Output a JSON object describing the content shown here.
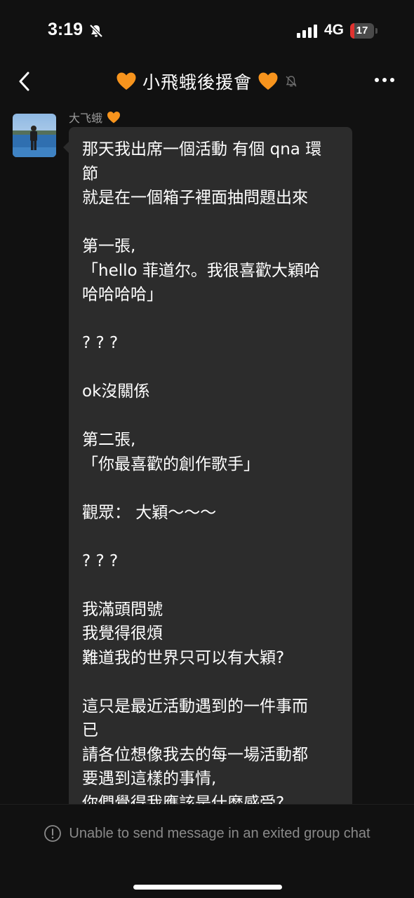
{
  "status_bar": {
    "time": "3:19",
    "network": "4G",
    "battery_level": "17",
    "battery_fraction": 0.17,
    "icons": [
      "bell-slash-icon",
      "signal-bars-icon",
      "battery-icon"
    ]
  },
  "header": {
    "title": "小飛蛾後援會",
    "icons": [
      "back-chevron-icon",
      "orange-heart-icon",
      "muted-bell-icon",
      "more-dots-icon"
    ],
    "accent_color": "#f7941d"
  },
  "message": {
    "sender_name": "大飞蛾",
    "sender_icon": "orange-heart-icon",
    "lines": [
      "那天我出席一個活動 有個 qna 環",
      "節",
      "就是在一個箱子裡面抽問題出來",
      "",
      "第一張,",
      "「hello 菲道尔。我很喜歡大穎哈",
      "哈哈哈哈」",
      "",
      "? ? ?",
      "",
      "ok沒關係",
      "",
      "第二張,",
      "「你最喜歡的創作歌手」",
      "",
      "觀眾： 大穎～～～",
      "",
      "? ? ?",
      "",
      "我滿頭問號",
      "我覺得很煩",
      "難道我的世界只可以有大穎?",
      "",
      "這只是最近活動遇到的一件事而",
      "已",
      "請各位想像我去的每一場活動都",
      "要遇到這樣的事情,",
      "你們覺得我應該是什麼感受?"
    ]
  },
  "footer": {
    "notice": "Unable to send message in an exited group chat",
    "icon": "info-circle-icon"
  }
}
